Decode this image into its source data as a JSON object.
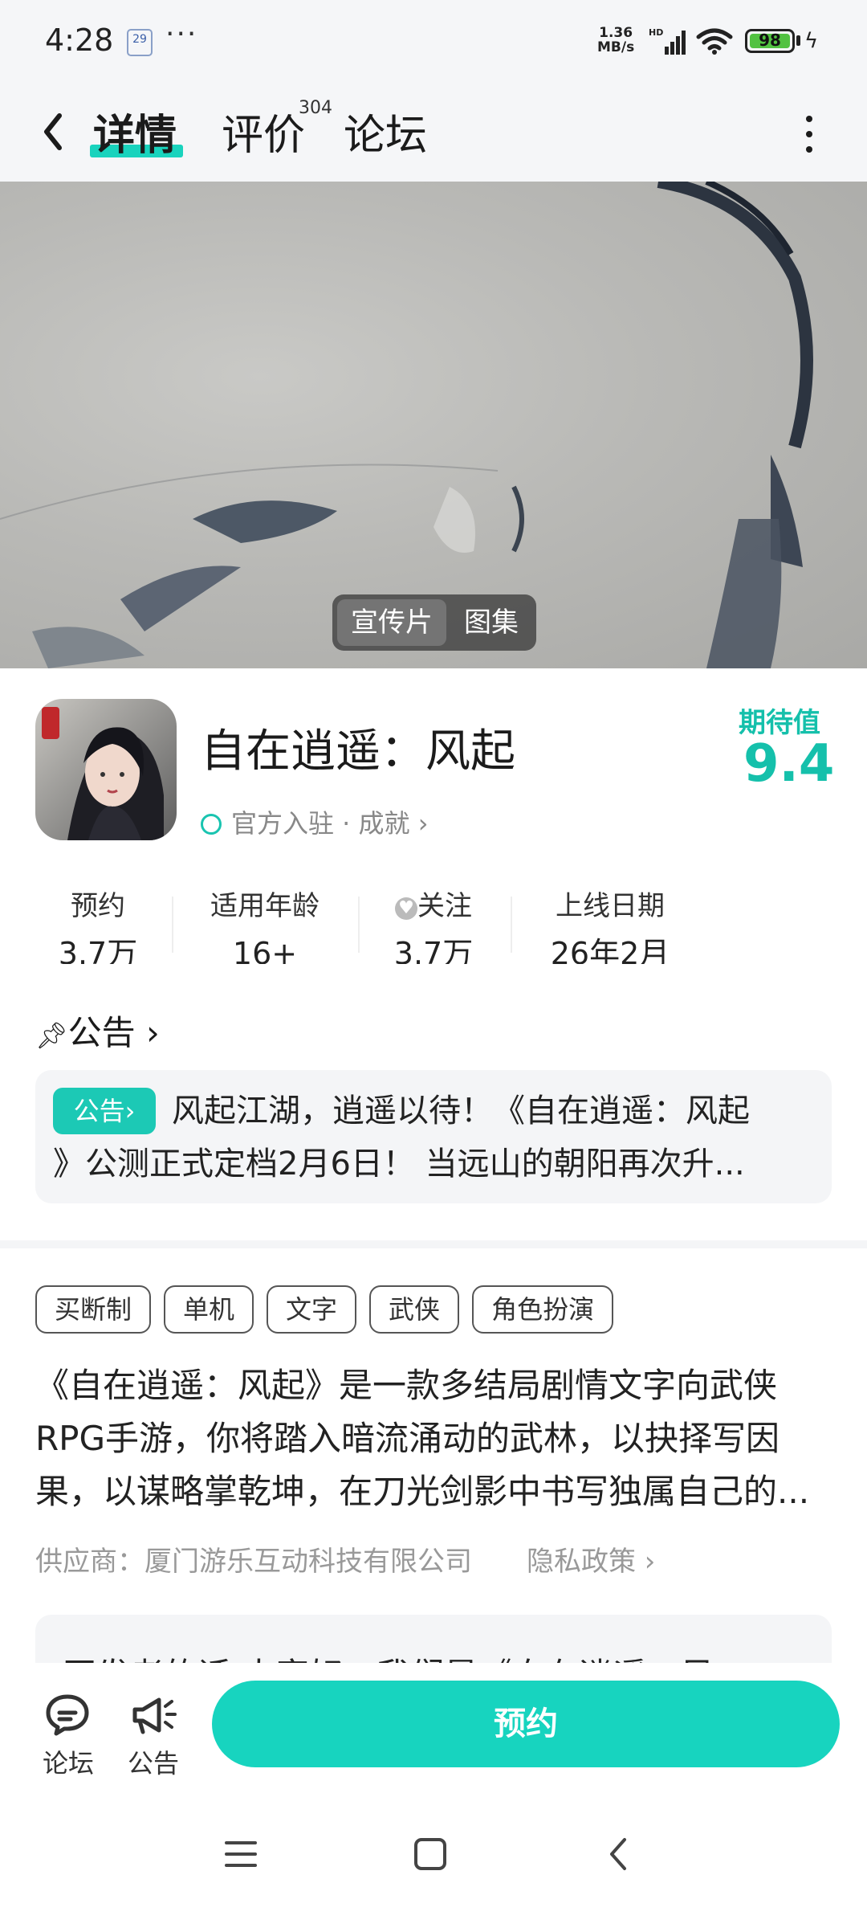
{
  "status_bar": {
    "time": "4:28",
    "calendar_badge": "29",
    "more": "···",
    "net_speed_value": "1.36",
    "net_speed_unit": "MB/s",
    "hd": "HD",
    "battery": "98"
  },
  "nav": {
    "tab_detail": "详情",
    "tab_review": "评价",
    "review_count": "304",
    "tab_forum": "论坛",
    "accent": "#19d3bd"
  },
  "hero": {
    "toggle_video": "宣传片",
    "toggle_gallery": "图集"
  },
  "app": {
    "name": "自在逍遥：风起",
    "verify": "官方入驻 · 成就",
    "expect_label": "期待值",
    "expect_value": "9.4"
  },
  "stats": [
    {
      "label": "预约",
      "value": "3.7万"
    },
    {
      "label": "适用年龄",
      "value": "16+"
    },
    {
      "label": "关注",
      "value": "3.7万"
    },
    {
      "label": "上线日期",
      "value": "26年2月"
    }
  ],
  "notice": {
    "heading": "公告",
    "badge": "公告",
    "line1": "风起江湖，逍遥以待！《自在逍遥：风起",
    "line2": "》公测正式定档2月6日！ 当远山的朝阳再次升..."
  },
  "tags": [
    "买断制",
    "单机",
    "文字",
    "武侠",
    "角色扮演"
  ],
  "description": {
    "line1": "《自在逍遥：风起》是一款多结局剧情文字向武侠",
    "line2": "RPG手游，你将踏入暗流涌动的武林，以抉择写因",
    "line3": "果，以谋略掌乾坤，在刀光剑影中书写独属自己的..."
  },
  "supplier": "供应商：厦门游乐互动科技有限公司",
  "privacy": "隐私政策",
  "developer_note": "开发者的话 大家好，我们是《自在逍遥：风",
  "action_bar": {
    "forum_label": "论坛",
    "notice_label": "公告",
    "reserve_label": "预约",
    "reserve_color": "#17d4bf"
  }
}
